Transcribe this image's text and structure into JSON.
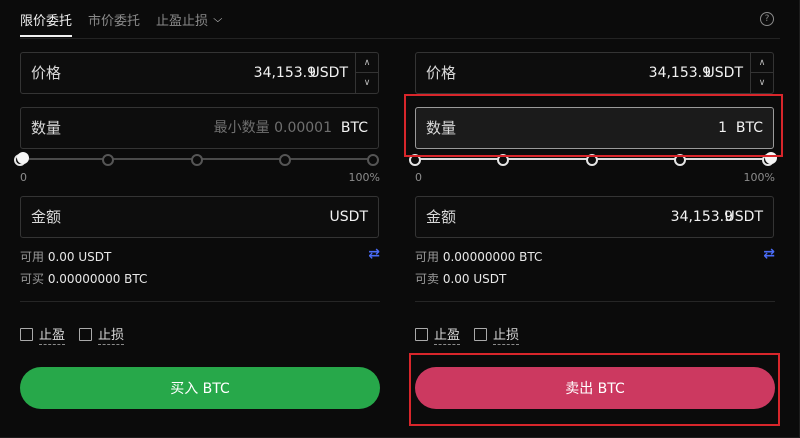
{
  "tabs": [
    {
      "label": "限价委托"
    },
    {
      "label": "市价委托"
    },
    {
      "label": "止盈止损"
    }
  ],
  "help_label": "?",
  "buy": {
    "price_label": "价格",
    "price_value": "34,153.9",
    "price_unit": "USDT",
    "qty_label": "数量",
    "qty_placeholder": "最小数量 0.00001",
    "qty_unit": "BTC",
    "slider_min": "0",
    "slider_max": "100%",
    "slider_percent": 0,
    "amount_label": "金额",
    "amount_value": "",
    "amount_unit": "USDT",
    "available_label": "可用",
    "available_value": "0.00 USDT",
    "max_label": "可买",
    "max_value": "0.00000000 BTC",
    "take_profit": "止盈",
    "stop_loss": "止损",
    "button": "买入 BTC"
  },
  "sell": {
    "price_label": "价格",
    "price_value": "34,153.9",
    "price_unit": "USDT",
    "qty_label": "数量",
    "qty_value": "1",
    "qty_unit": "BTC",
    "slider_min": "0",
    "slider_max": "100%",
    "slider_percent": 100,
    "amount_label": "金额",
    "amount_value": "34,153.9",
    "amount_unit": "USDT",
    "available_label": "可用",
    "available_value": "0.00000000 BTC",
    "max_label": "可卖",
    "max_value": "0.00 USDT",
    "take_profit": "止盈",
    "stop_loss": "止损",
    "button": "卖出 BTC"
  },
  "icons": {
    "swap": "⇄",
    "up": "∧",
    "down": "∨",
    "chevron": "⌄"
  },
  "colors": {
    "buy": "#27a84a",
    "sell": "#cc3960",
    "highlight": "#d8262b",
    "swap": "#4a6cf7"
  }
}
